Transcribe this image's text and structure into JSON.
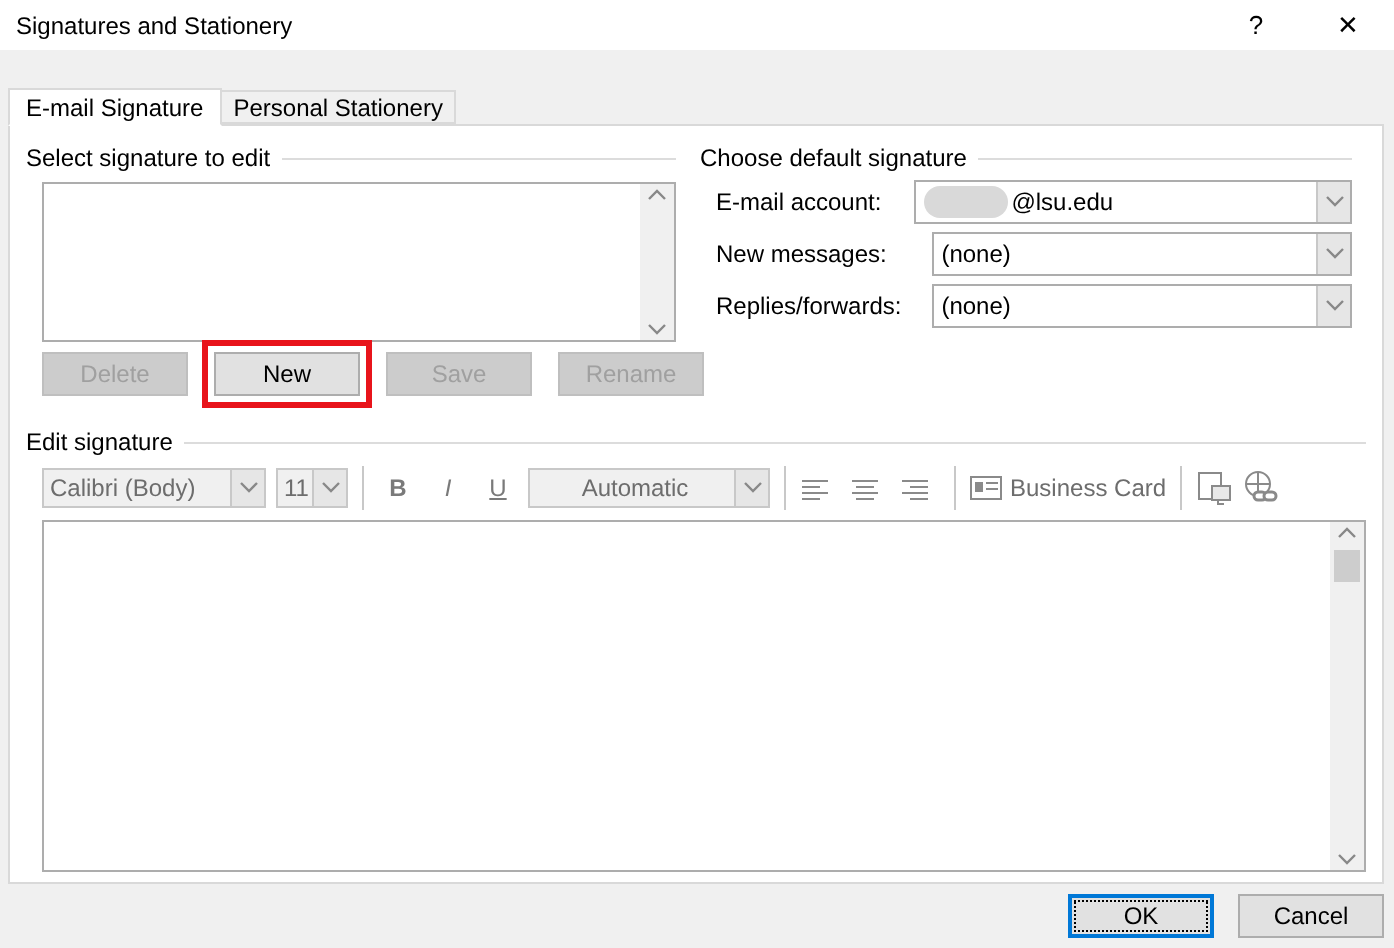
{
  "window": {
    "title": "Signatures and Stationery",
    "help": "?",
    "close": "✕"
  },
  "tabs": [
    {
      "label": "E-mail Signature",
      "selected": true
    },
    {
      "label": "Personal Stationery",
      "selected": false
    }
  ],
  "select_signature": {
    "heading": "Select signature to edit",
    "buttons": [
      {
        "label": "Delete",
        "disabled": true,
        "highlighted": false
      },
      {
        "label": "New",
        "disabled": false,
        "highlighted": true
      },
      {
        "label": "Save",
        "disabled": true,
        "highlighted": false
      },
      {
        "label": "Rename",
        "disabled": true,
        "highlighted": false
      }
    ]
  },
  "default_signature": {
    "heading": "Choose default signature",
    "fields": [
      {
        "label": "E-mail account:",
        "value": "@lsu.edu",
        "redacted": true
      },
      {
        "label": "New messages:",
        "value": "(none)",
        "redacted": false
      },
      {
        "label": "Replies/forwards:",
        "value": "(none)",
        "redacted": false
      }
    ]
  },
  "edit_signature": {
    "heading": "Edit signature",
    "toolbar_disabled": true,
    "toolbar": [
      {
        "kind": "font",
        "value": "Calibri (Body)"
      },
      {
        "kind": "size",
        "value": "11"
      },
      {
        "kind": "separator"
      },
      {
        "kind": "bold",
        "label": "B"
      },
      {
        "kind": "italic",
        "label": "I"
      },
      {
        "kind": "underline",
        "label": "U"
      },
      {
        "kind": "color",
        "value": "Automatic"
      },
      {
        "kind": "separator"
      },
      {
        "kind": "align-left"
      },
      {
        "kind": "align-center"
      },
      {
        "kind": "align-right"
      },
      {
        "kind": "separator"
      },
      {
        "kind": "business-card",
        "label": "Business Card"
      },
      {
        "kind": "separator"
      },
      {
        "kind": "picture"
      },
      {
        "kind": "hyperlink"
      }
    ]
  },
  "footer": [
    {
      "label": "OK",
      "default": true
    },
    {
      "label": "Cancel",
      "default": false
    }
  ]
}
